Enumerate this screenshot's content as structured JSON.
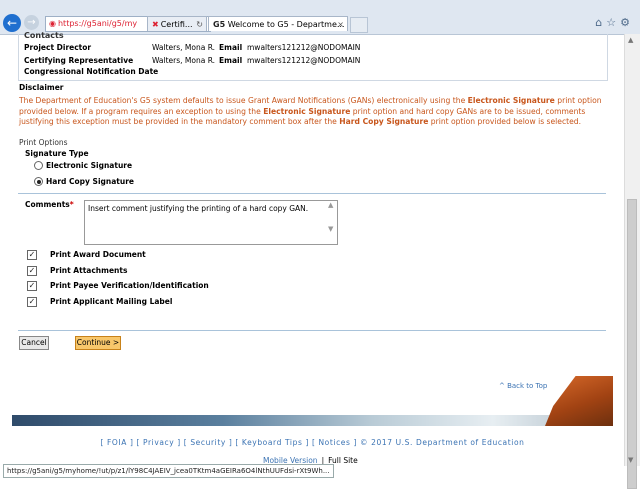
{
  "browser": {
    "address_url": "https://g5ani/g5/my",
    "tab1_label": "Certifi...",
    "tab2_label": "Welcome to G5 - Departme...",
    "tab_icon_text": "G5",
    "status_url": "https://g5ani/g5/myhome/!ut/p/z1/lY98C4JAEIV_jcea0TKtm4aGEIRa6O4lNthUUFdsi-rXt9Wh..."
  },
  "contacts": {
    "header": "Contacts",
    "rows": [
      {
        "label": "Project Director",
        "name": "Walters, Mona R.",
        "email_label": "Email",
        "email": "mwalters121212@NODOMAIN"
      },
      {
        "label": "Certifying Representative",
        "name": "Walters, Mona R.",
        "email_label": "Email",
        "email": "mwalters121212@NODOMAIN"
      },
      {
        "label": "Congressional Notification Date"
      }
    ]
  },
  "disclaimer": {
    "header": "Disclaimer",
    "p1": "The Department of Education's G5 system defaults to issue Grant Award Notifications (GANs) electronically using the ",
    "b1": "Electronic Signature",
    "p2": " print option provided below. If a program requires an exception to using the ",
    "b2": "Electronic Signature",
    "p3": " print option and hard copy GANs are to be issued, comments justifying this exception must be provided in the mandatory comment box after the ",
    "b3": "Hard Copy Signature",
    "p4": " print option provided below is selected."
  },
  "print_options": {
    "header": "Print Options",
    "signature_type_label": "Signature Type",
    "electronic_label": "Electronic Signature",
    "hardcopy_label": "Hard Copy Signature",
    "selected": "Hard Copy Signature",
    "comments_label": "Comments",
    "comments_required_mark": "*",
    "comments_value": "Insert comment justifying the printing of a hard copy GAN.",
    "checkboxes": [
      {
        "label": "Print Award Document",
        "checked": true
      },
      {
        "label": "Print Attachments",
        "checked": true
      },
      {
        "label": "Print Payee Verification/Identification",
        "checked": true
      },
      {
        "label": "Print Applicant Mailing Label",
        "checked": true
      }
    ]
  },
  "buttons": {
    "cancel": "Cancel",
    "continue": "Continue >"
  },
  "back_to_top": "^ Back to Top",
  "footer": {
    "links": "[ FOIA ]  [ Privacy ]  [ Security ]  [ Keyboard Tips ]  [ Notices ]    © 2017 U.S. Department of Education",
    "mobile": "Mobile Version",
    "sep": "|",
    "full": "Full Site"
  },
  "colors": {
    "disclaimer_text": "#c8561c",
    "link": "#3b73b3",
    "continue_button": "#f8c76b"
  }
}
